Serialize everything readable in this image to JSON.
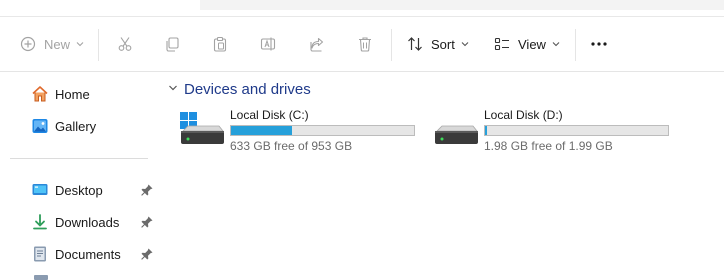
{
  "toolbar": {
    "new_label": "New",
    "sort_label": "Sort",
    "view_label": "View",
    "more_label": "..."
  },
  "sidebar": {
    "items": [
      {
        "label": "Home",
        "icon": "home-icon",
        "pinned": false
      },
      {
        "label": "Gallery",
        "icon": "gallery-icon",
        "pinned": false
      },
      {
        "label": "Desktop",
        "icon": "desktop-icon",
        "pinned": true
      },
      {
        "label": "Downloads",
        "icon": "downloads-icon",
        "pinned": true
      },
      {
        "label": "Documents",
        "icon": "documents-icon",
        "pinned": true
      }
    ]
  },
  "main": {
    "group_label": "Devices and drives",
    "drives": [
      {
        "name": "Local Disk (C:)",
        "free_text": "633 GB free of 953 GB",
        "used_fraction": 0.336,
        "system_drive": true
      },
      {
        "name": "Local Disk (D:)",
        "free_text": "1.98 GB free of 1.99 GB",
        "used_fraction": 0.01,
        "system_drive": false
      }
    ]
  },
  "colors": {
    "accent": "#26a0da",
    "group_header": "#1f3a8a",
    "disabled": "#a3a3a3"
  }
}
